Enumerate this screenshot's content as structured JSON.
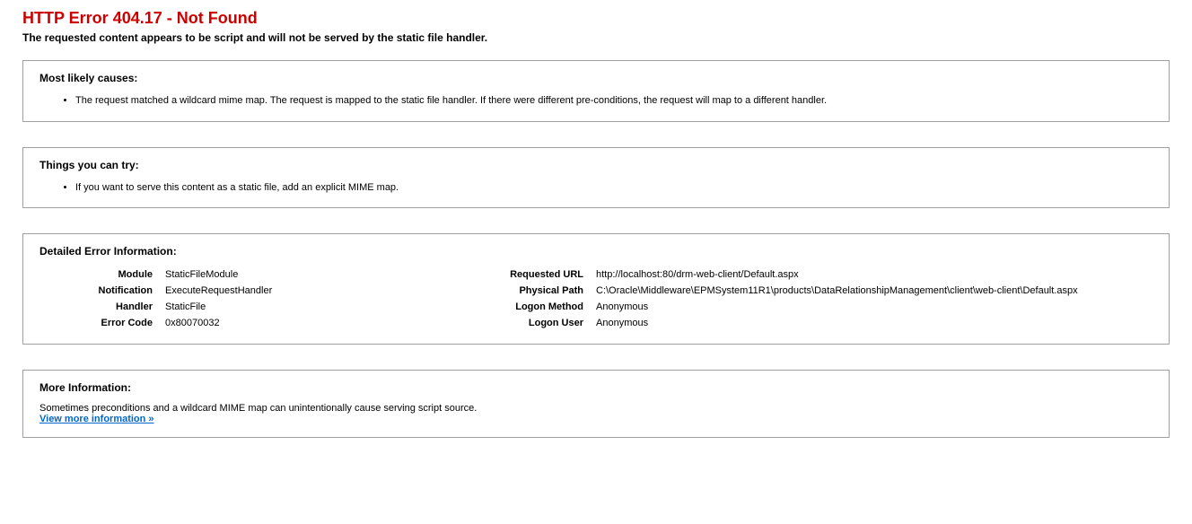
{
  "title": "HTTP Error 404.17 - Not Found",
  "subtitle": "The requested content appears to be script and will not be served by the static file handler.",
  "causes": {
    "heading": "Most likely causes:",
    "items": [
      "The request matched a wildcard mime map. The request is mapped to the static file handler. If there were different pre-conditions, the request will map to a different handler."
    ]
  },
  "tryThings": {
    "heading": "Things you can try:",
    "items": [
      "If you want to serve this content as a static file, add an explicit MIME map."
    ]
  },
  "details": {
    "heading": "Detailed Error Information:",
    "left": {
      "module_label": "Module",
      "module_value": "StaticFileModule",
      "notification_label": "Notification",
      "notification_value": "ExecuteRequestHandler",
      "handler_label": "Handler",
      "handler_value": "StaticFile",
      "errorcode_label": "Error Code",
      "errorcode_value": "0x80070032"
    },
    "right": {
      "requrl_label": "Requested URL",
      "requrl_value": "http://localhost:80/drm-web-client/Default.aspx",
      "physpath_label": "Physical Path",
      "physpath_value": "C:\\Oracle\\Middleware\\EPMSystem11R1\\products\\DataRelationshipManagement\\client\\web-client\\Default.aspx",
      "logonmethod_label": "Logon Method",
      "logonmethod_value": "Anonymous",
      "logonuser_label": "Logon User",
      "logonuser_value": "Anonymous"
    }
  },
  "moreInfo": {
    "heading": "More Information:",
    "text": "Sometimes preconditions and a wildcard MIME map can unintentionally cause serving script source.",
    "link": "View more information »"
  }
}
